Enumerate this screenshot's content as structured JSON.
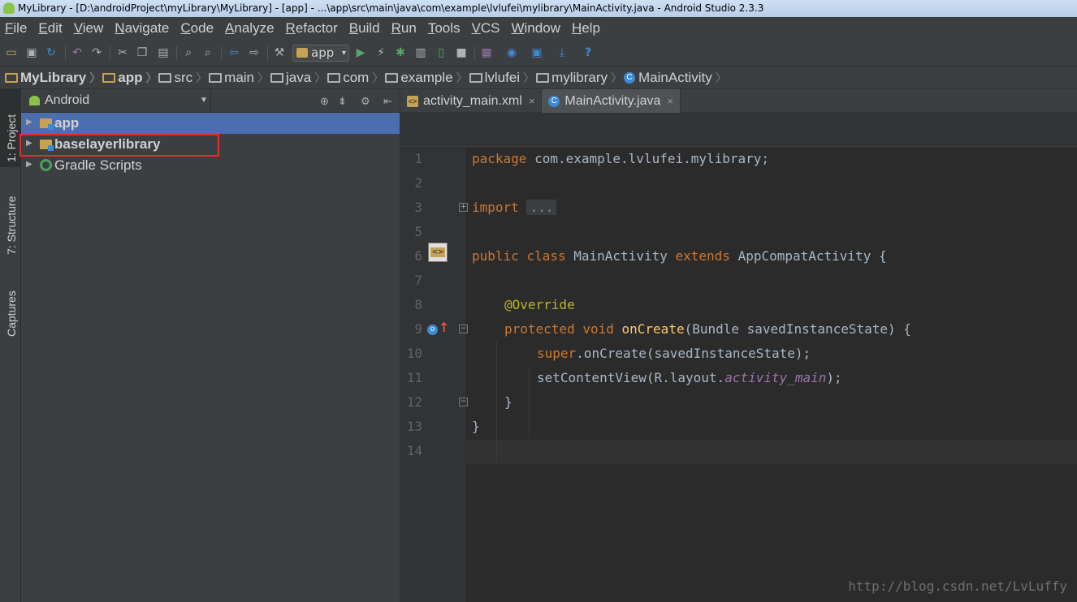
{
  "window": {
    "title": "MyLibrary - [D:\\androidProject\\myLibrary\\MyLibrary] - [app] - ...\\app\\src\\main\\java\\com\\example\\lvlufei\\mylibrary\\MainActivity.java - Android Studio 2.3.3"
  },
  "menu": {
    "items": [
      "File",
      "Edit",
      "View",
      "Navigate",
      "Code",
      "Analyze",
      "Refactor",
      "Build",
      "Run",
      "Tools",
      "VCS",
      "Window",
      "Help"
    ]
  },
  "toolbar": {
    "run_config": "app"
  },
  "navbar": {
    "crumbs": [
      "MyLibrary",
      "app",
      "src",
      "main",
      "java",
      "com",
      "example",
      "lvlufei",
      "mylibrary",
      "MainActivity"
    ]
  },
  "tool_windows": {
    "project": "1: Project",
    "structure": "7: Structure",
    "captures": "Captures"
  },
  "project_panel": {
    "view_mode": "Android",
    "tree": [
      {
        "label": "app",
        "selected": true
      },
      {
        "label": "baselayerlibrary",
        "selected": false
      },
      {
        "label": "Gradle Scripts",
        "selected": false
      }
    ]
  },
  "editor": {
    "tabs": [
      {
        "label": "activity_main.xml",
        "active": false
      },
      {
        "label": "MainActivity.java",
        "active": true
      }
    ],
    "line_numbers": [
      "1",
      "2",
      "3",
      "5",
      "6",
      "7",
      "8",
      "9",
      "10",
      "11",
      "12",
      "13",
      "14"
    ],
    "code": {
      "l1_kw": "package",
      "l1_rest": " com.example.lvlufei.mylibrary;",
      "l3_kw": "import",
      "l3_fold": "...",
      "l6_kw1": "public",
      "l6_kw2": "class",
      "l6_name": "MainActivity",
      "l6_kw3": "extends",
      "l6_rest": "AppCompatActivity {",
      "l8_ann": "@Override",
      "l9_kw1": "protected",
      "l9_kw2": "void",
      "l9_fn": "onCreate",
      "l9_rest": "(Bundle savedInstanceState) {",
      "l10_kw": "super",
      "l10_rest": ".onCreate(savedInstanceState);",
      "l11_a": "setContentView(R.layout.",
      "l11_field": "activity_main",
      "l11_b": ");",
      "l12": "}",
      "l13": "}"
    }
  },
  "watermark": "http://blog.csdn.net/LvLuffy",
  "colors": {
    "keyword": "#cc7832",
    "annotation": "#bbb529",
    "method": "#ffc66d",
    "field": "#9876aa",
    "selection": "#4b6eaf",
    "highlight_box": "#e52b2b"
  }
}
